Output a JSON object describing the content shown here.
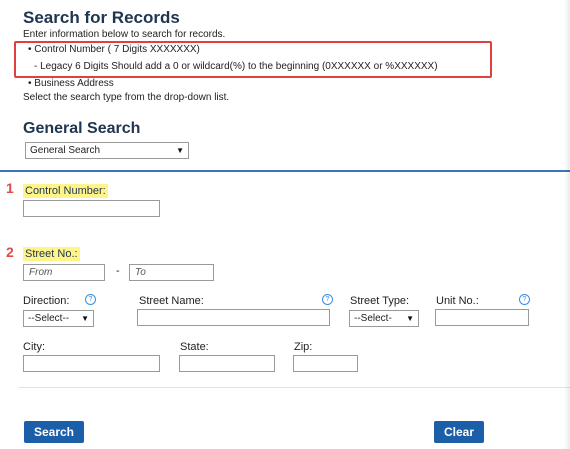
{
  "header": {
    "title": "Search for Records",
    "intro": "Enter information below to search for records.",
    "bullet_control": "• Control Number ( 7 Digits XXXXXXX)",
    "bullet_legacy": "- Legacy 6 Digits Should add a 0 or wildcard(%) to the beginning (0XXXXXX or %XXXXXX)",
    "bullet_business": "• Business Address",
    "select_hint": "Select the search type from the drop-down list."
  },
  "general": {
    "title": "General Search",
    "select_value": "General Search"
  },
  "markers": {
    "one": "1",
    "two": "2"
  },
  "fields": {
    "control_label": "Control Number:",
    "control_value": "",
    "street_no_label": "Street No.:",
    "street_from_placeholder": "From",
    "street_to_placeholder": "To",
    "dash": "-",
    "direction_label": "Direction:",
    "direction_value": "--Select--",
    "street_name_label": "Street Name:",
    "street_type_label": "Street Type:",
    "street_type_value": "--Select-",
    "unit_label": "Unit No.:",
    "city_label": "City:",
    "state_label": "State:",
    "zip_label": "Zip:",
    "help_glyph": "?"
  },
  "buttons": {
    "search": "Search",
    "clear": "Clear"
  }
}
